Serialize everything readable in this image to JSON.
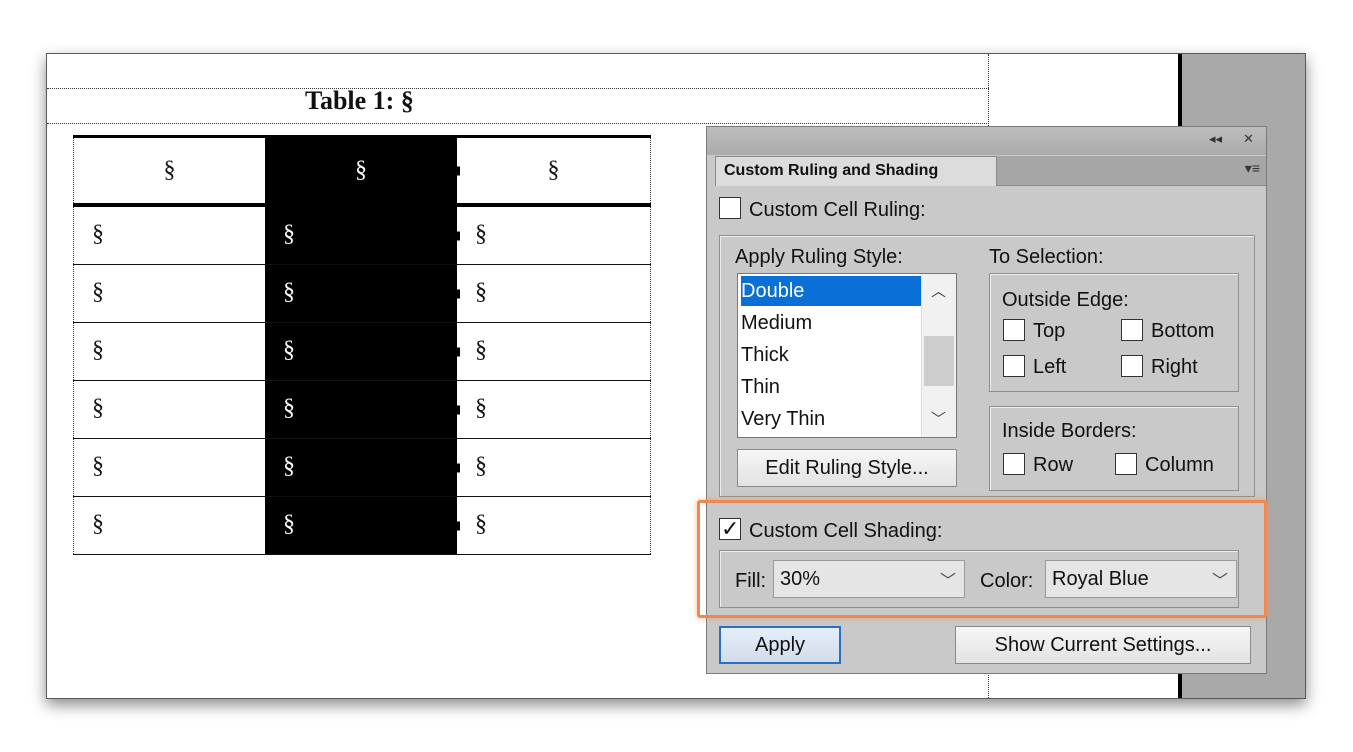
{
  "document": {
    "caption": "Table 1: §",
    "table": {
      "header": [
        "§",
        "§",
        "§"
      ],
      "rows": [
        [
          "§",
          "§",
          "§"
        ],
        [
          "§",
          "§",
          "§"
        ],
        [
          "§",
          "§",
          "§"
        ],
        [
          "§",
          "§",
          "§"
        ],
        [
          "§",
          "§",
          "§"
        ],
        [
          "§",
          "§",
          "§"
        ]
      ]
    }
  },
  "panel": {
    "title_controls": {
      "collapse": "◂◂",
      "close": "✕"
    },
    "tab_label": "Custom Ruling and Shading",
    "menu_icon": "▾≡",
    "custom_cell_ruling": {
      "label": "Custom Cell Ruling:",
      "checked": false
    },
    "apply_ruling_style_label": "Apply Ruling Style:",
    "ruling_styles": [
      "Double",
      "Medium",
      "Thick",
      "Thin",
      "Very Thin"
    ],
    "selected_style": "Double",
    "edit_ruling_button": "Edit Ruling Style...",
    "to_selection_label": "To Selection:",
    "outside_edge": {
      "label": "Outside Edge:",
      "top": "Top",
      "bottom": "Bottom",
      "left": "Left",
      "right": "Right"
    },
    "inside_borders": {
      "label": "Inside Borders:",
      "row": "Row",
      "column": "Column"
    },
    "custom_cell_shading": {
      "label": "Custom Cell Shading:",
      "checked": true
    },
    "fill": {
      "label": "Fill:",
      "value": "30%"
    },
    "color": {
      "label": "Color:",
      "value": "Royal Blue"
    },
    "apply_button": "Apply",
    "show_settings_button": "Show Current Settings..."
  },
  "colors": {
    "highlight": "#f0884f",
    "selection": "#0a6fd6"
  }
}
